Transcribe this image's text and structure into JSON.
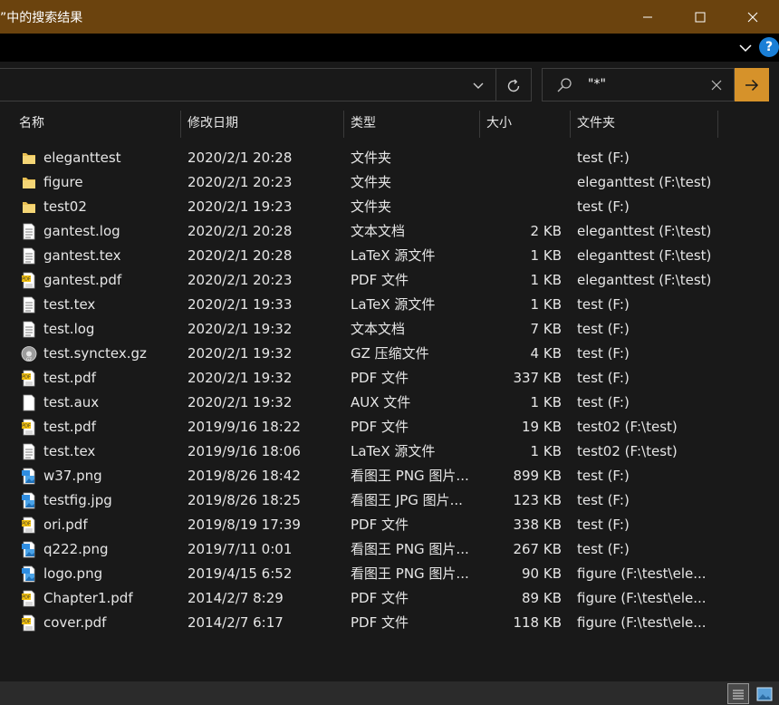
{
  "window": {
    "title": "”中的搜索结果"
  },
  "search": {
    "value": "\"*\""
  },
  "columns": {
    "name": "名称",
    "date": "修改日期",
    "type": "类型",
    "size": "大小",
    "folder": "文件夹"
  },
  "files": [
    {
      "name": "eleganttest",
      "date": "2020/2/1 20:28",
      "type": "文件夹",
      "size": "",
      "folder": "test (F:)",
      "icon": "folder-icon"
    },
    {
      "name": "figure",
      "date": "2020/2/1 20:23",
      "type": "文件夹",
      "size": "",
      "folder": "eleganttest (F:\\test)",
      "icon": "folder-icon"
    },
    {
      "name": "test02",
      "date": "2020/2/1 19:23",
      "type": "文件夹",
      "size": "",
      "folder": "test (F:)",
      "icon": "folder-icon"
    },
    {
      "name": "gantest.log",
      "date": "2020/2/1 20:28",
      "type": "文本文档",
      "size": "2 KB",
      "folder": "eleganttest (F:\\test)",
      "icon": "text-file-icon"
    },
    {
      "name": "gantest.tex",
      "date": "2020/2/1 20:28",
      "type": "LaTeX 源文件",
      "size": "1 KB",
      "folder": "eleganttest (F:\\test)",
      "icon": "text-file-icon"
    },
    {
      "name": "gantest.pdf",
      "date": "2020/2/1 20:23",
      "type": "PDF 文件",
      "size": "1 KB",
      "folder": "eleganttest (F:\\test)",
      "icon": "pdf-file-icon"
    },
    {
      "name": "test.tex",
      "date": "2020/2/1 19:33",
      "type": "LaTeX 源文件",
      "size": "1 KB",
      "folder": "test (F:)",
      "icon": "text-file-icon"
    },
    {
      "name": "test.log",
      "date": "2020/2/1 19:32",
      "type": "文本文档",
      "size": "7 KB",
      "folder": "test (F:)",
      "icon": "text-file-icon"
    },
    {
      "name": "test.synctex.gz",
      "date": "2020/2/1 19:32",
      "type": "GZ 压缩文件",
      "size": "4 KB",
      "folder": "test (F:)",
      "icon": "gz-archive-icon"
    },
    {
      "name": "test.pdf",
      "date": "2020/2/1 19:32",
      "type": "PDF 文件",
      "size": "337 KB",
      "folder": "test (F:)",
      "icon": "pdf-file-icon"
    },
    {
      "name": "test.aux",
      "date": "2020/2/1 19:32",
      "type": "AUX 文件",
      "size": "1 KB",
      "folder": "test (F:)",
      "icon": "blank-file-icon"
    },
    {
      "name": "test.pdf",
      "date": "2019/9/16 18:22",
      "type": "PDF 文件",
      "size": "19 KB",
      "folder": "test02 (F:\\test)",
      "icon": "pdf-file-icon"
    },
    {
      "name": "test.tex",
      "date": "2019/9/16 18:06",
      "type": "LaTeX 源文件",
      "size": "1 KB",
      "folder": "test02 (F:\\test)",
      "icon": "text-file-icon"
    },
    {
      "name": "w37.png",
      "date": "2019/8/26 18:42",
      "type": "看图王 PNG 图片...",
      "size": "899 KB",
      "folder": "test (F:)",
      "icon": "image-file-icon"
    },
    {
      "name": "testfig.jpg",
      "date": "2019/8/26 18:25",
      "type": "看图王 JPG 图片...",
      "size": "123 KB",
      "folder": "test (F:)",
      "icon": "image-file-icon"
    },
    {
      "name": "ori.pdf",
      "date": "2019/8/19 17:39",
      "type": "PDF 文件",
      "size": "338 KB",
      "folder": "test (F:)",
      "icon": "pdf-file-icon"
    },
    {
      "name": "q222.png",
      "date": "2019/7/11 0:01",
      "type": "看图王 PNG 图片...",
      "size": "267 KB",
      "folder": "test (F:)",
      "icon": "image-file-icon"
    },
    {
      "name": "logo.png",
      "date": "2019/4/15 6:52",
      "type": "看图王 PNG 图片...",
      "size": "90 KB",
      "folder": "figure (F:\\test\\ele...",
      "icon": "image-file-icon"
    },
    {
      "name": "Chapter1.pdf",
      "date": "2014/2/7 8:29",
      "type": "PDF 文件",
      "size": "89 KB",
      "folder": "figure (F:\\test\\ele...",
      "icon": "pdf-file-icon"
    },
    {
      "name": "cover.pdf",
      "date": "2014/2/7 6:17",
      "type": "PDF 文件",
      "size": "118 KB",
      "folder": "figure (F:\\test\\ele...",
      "icon": "pdf-file-icon"
    }
  ],
  "colors": {
    "titlebar": "#6b430e",
    "search_go": "#d6922a",
    "help": "#1a7fd6"
  }
}
